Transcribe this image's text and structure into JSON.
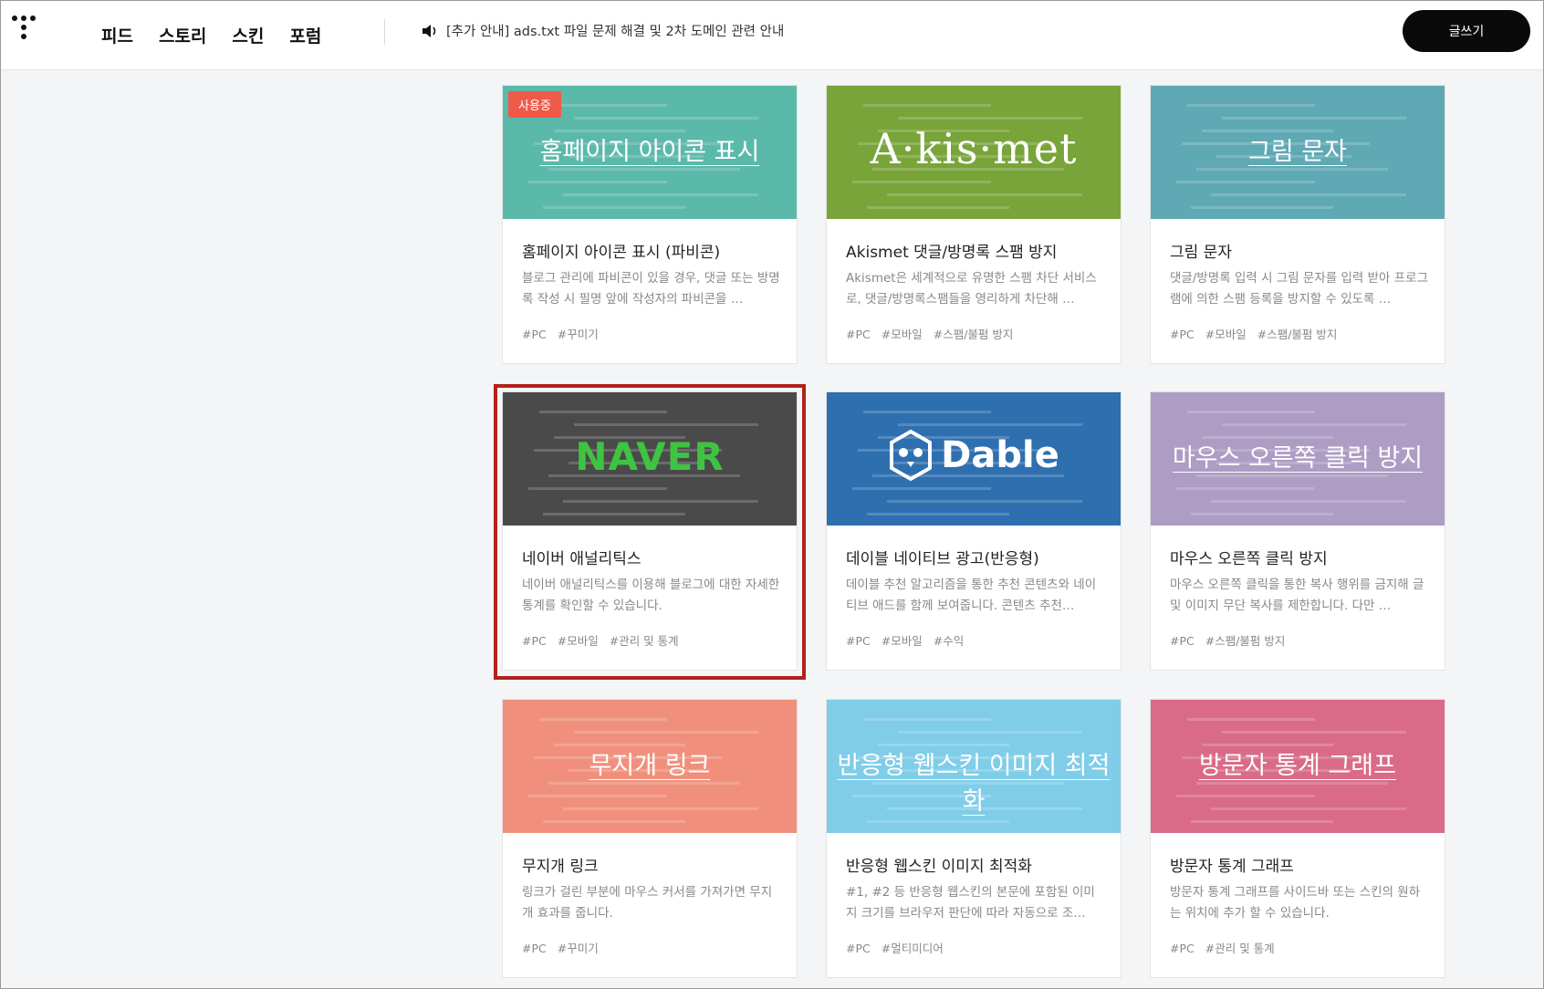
{
  "header": {
    "nav": [
      "피드",
      "스토리",
      "스킨",
      "포럼"
    ],
    "notice": "[추가 안내] ads.txt 파일 문제 해결 및 2차 도메인 관련 안내",
    "write_button": "글쓰기"
  },
  "cards": [
    {
      "thumb_text": "홈페이지 아이콘 표시",
      "badge": "사용중",
      "title": "홈페이지 아이콘 표시 (파비콘)",
      "desc": "블로그 관리에 파비콘이 있을 경우, 댓글 또는 방명록 작성 시 필명 앞에 작성자의 파비콘을 …",
      "tags": [
        "#PC",
        "#꾸미기"
      ],
      "color": "#5bb9a9"
    },
    {
      "thumb_text": "A·kis·met",
      "title": "Akismet 댓글/방명록 스팸 방지",
      "desc": "Akismet은 세계적으로 유명한 스팸 차단 서비스로, 댓글/방명록스팸들을 영리하게 차단해 …",
      "tags": [
        "#PC",
        "#모바일",
        "#스팸/불펌 방지"
      ],
      "color": "#79a43a"
    },
    {
      "thumb_text": "그림 문자",
      "title": "그림 문자",
      "desc": "댓글/방명록 입력 시 그림 문자를 입력 받아 프로그램에 의한 스팸 등록을 방지할 수 있도록 …",
      "tags": [
        "#PC",
        "#모바일",
        "#스팸/불펌 방지"
      ],
      "color": "#5fa9b4"
    },
    {
      "thumb_text": "NAVER",
      "title": "네이버 애널리틱스",
      "desc": "네이버 애널리틱스를 이용해 블로그에 대한 자세한 통계를 확인할 수 있습니다.",
      "tags": [
        "#PC",
        "#모바일",
        "#관리 및 통계"
      ],
      "color": "#4a4a4a"
    },
    {
      "thumb_text": "Dable",
      "title": "데이블 네이티브 광고(반응형)",
      "desc": "데이블 추천 알고리즘을 통한 추천 콘텐츠와 네이티브 애드를 함께 보여줍니다. 콘텐츠 추천…",
      "tags": [
        "#PC",
        "#모바일",
        "#수익"
      ],
      "color": "#2e6fb0"
    },
    {
      "thumb_text": "마우스 오른쪽 클릭 방지",
      "title": "마우스 오른쪽 클릭 방지",
      "desc": "마우스 오른쪽 클릭을 통한 복사 행위를 금지해 글 및 이미지 무단 복사를 제한합니다. 다만 …",
      "tags": [
        "#PC",
        "#스팸/불펌 방지"
      ],
      "color": "#ad9cc4"
    },
    {
      "thumb_text": "무지개 링크",
      "title": "무지개 링크",
      "desc": "링크가 걸린 부분에 마우스 커서를 가져가면 무지개 효과를 줍니다.",
      "tags": [
        "#PC",
        "#꾸미기"
      ],
      "color": "#f0907c"
    },
    {
      "thumb_text": "반응형 웹스킨 이미지 최적화",
      "title": "반응형 웹스킨 이미지 최적화",
      "desc": "#1, #2 등 반응형 웹스킨의 본문에 포함된 이미지 크기를 브라우저 판단에 따라 자동으로 조…",
      "tags": [
        "#PC",
        "#멀티미디어"
      ],
      "color": "#7fcde8"
    },
    {
      "thumb_text": "방문자 통계 그래프",
      "title": "방문자 통계 그래프",
      "desc": "방문자 통계 그래프를 사이드바 또는 스킨의 원하는 위치에 추가 할 수 있습니다.",
      "tags": [
        "#PC",
        "#관리 및 통계"
      ],
      "color": "#d96b88"
    }
  ]
}
